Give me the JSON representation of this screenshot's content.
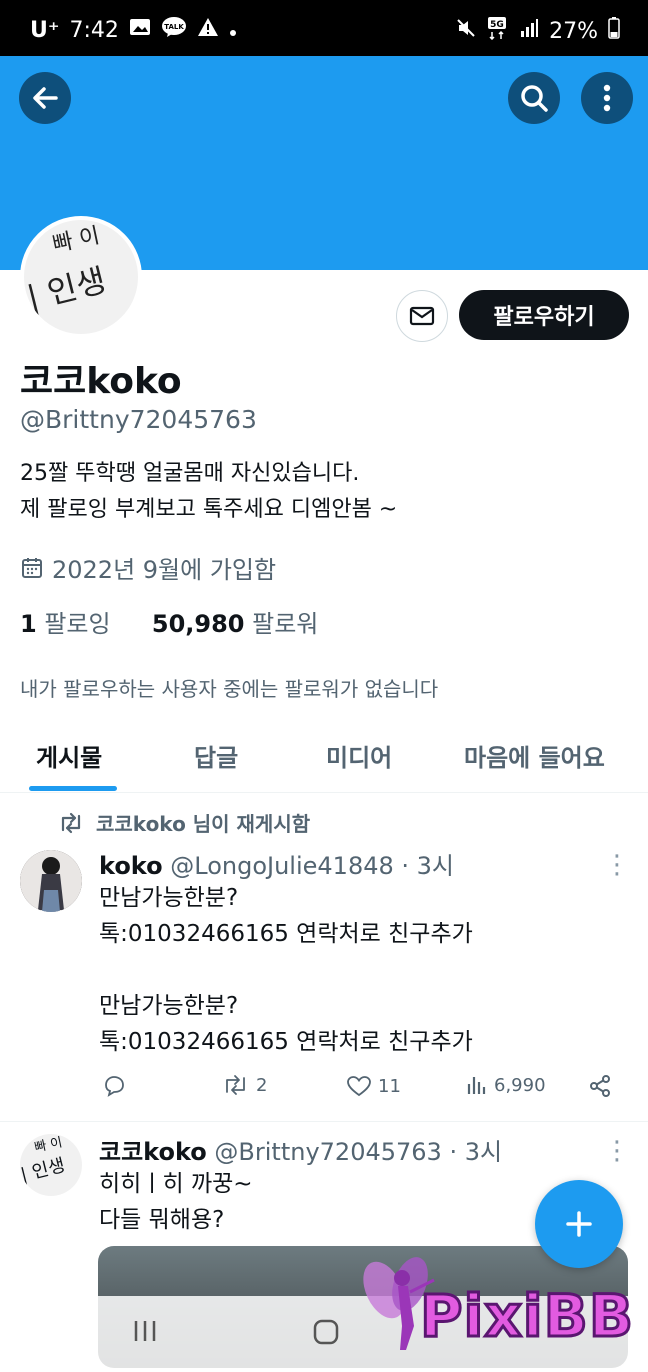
{
  "status_bar": {
    "carrier": "U⁺",
    "time": "7:42",
    "battery": "27%",
    "network": "5G"
  },
  "header": {
    "back_icon": "arrow-left-icon",
    "search_icon": "search-icon",
    "more_icon": "more-vertical-icon",
    "banner_color": "#1d9bf0"
  },
  "profile": {
    "avatar_text_1": "빠 이",
    "avatar_text_2": "| 인생",
    "follow_label": "팔로우하기",
    "display_name": "코코koko",
    "handle": "@Brittny72045763",
    "bio_line1": "25짤 뚜학땡 얼굴몸매 자신있습니다.",
    "bio_line2": "제 팔로잉 부계보고 톡주세요 디엠안봄 ~",
    "joined": "2022년 9월에 가입함",
    "following_count": "1",
    "following_label": "팔로잉",
    "followers_count": "50,980",
    "followers_label": "팔로워",
    "no_common_followers": "내가 팔로우하는 사용자 중에는 팔로워가 없습니다"
  },
  "tabs": [
    "게시물",
    "답글",
    "미디어",
    "마음에 들어요"
  ],
  "tweets": [
    {
      "retweet_note": "코코koko 님이 재게시함",
      "name": "koko",
      "handle": "@LongoJulie41848",
      "time": "· 3시",
      "body_l1": "만남가능한분?",
      "body_l2": "톡:01032466165 연락처로 친구추가",
      "body_l3": "만남가능한분?",
      "body_l4": "톡:01032466165 연락처로 친구추가",
      "retweets": "2",
      "likes": "11",
      "views": "6,990"
    },
    {
      "name": "코코koko",
      "handle": "@Brittny72045763",
      "time": "· 3시",
      "body_l1": "히히ㅣ히 까꿍~",
      "body_l2": "다들 뭐해용?"
    }
  ],
  "watermark": "PixiBB",
  "accent_color": "#1d9bf0"
}
